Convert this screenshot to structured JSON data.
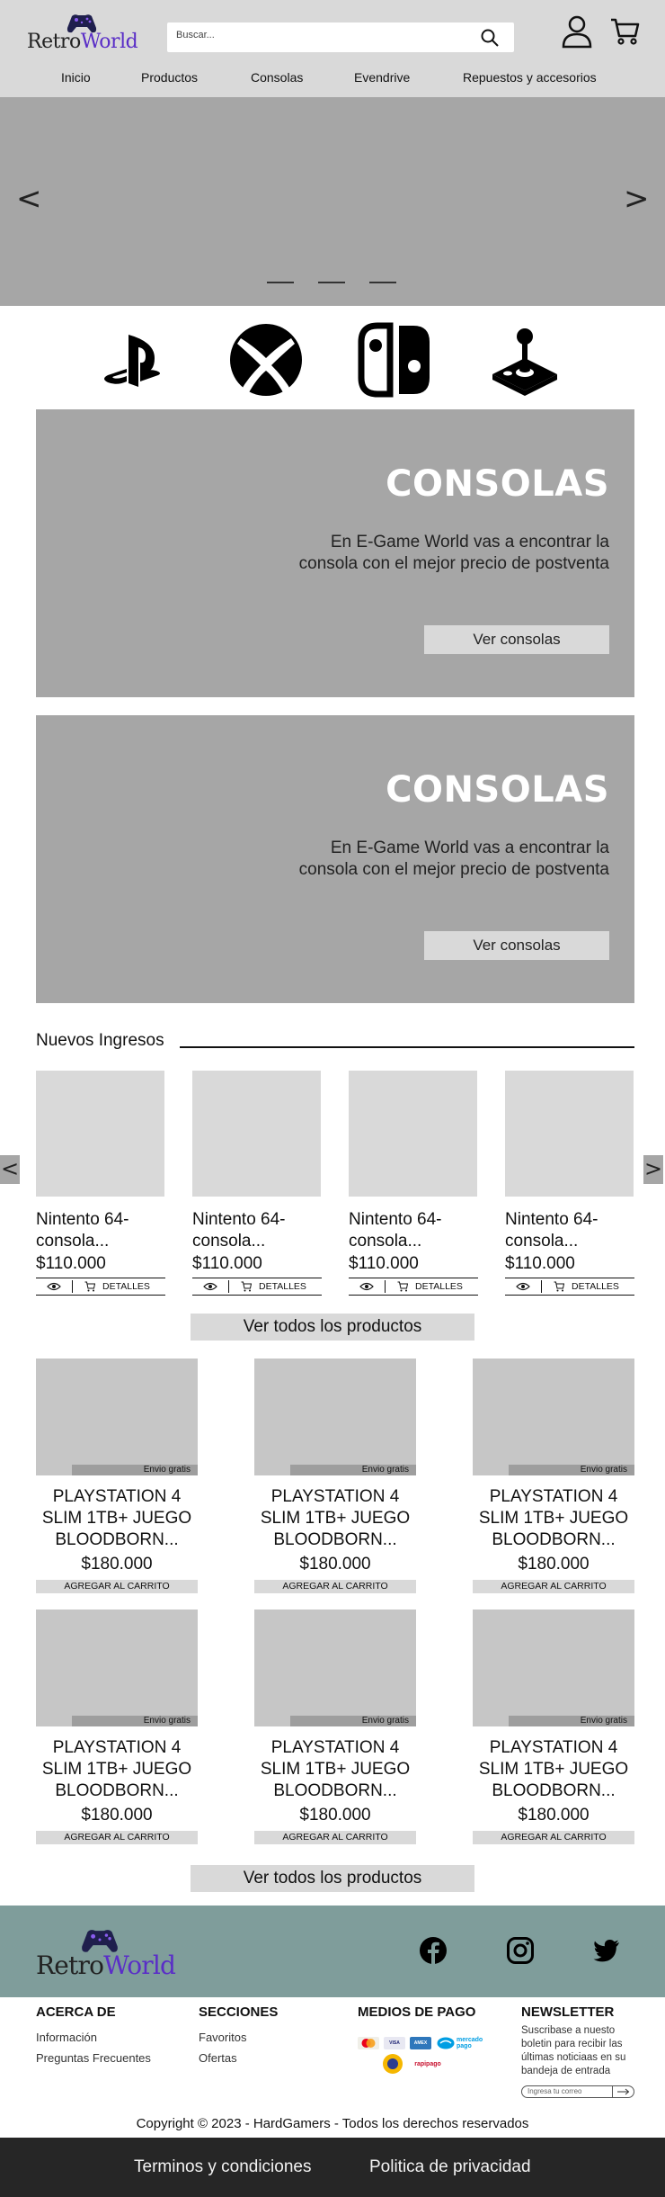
{
  "header": {
    "logo": {
      "part1": "Retro",
      "part2": "World"
    },
    "search_placeholder": "Buscar...",
    "nav": [
      "Inicio",
      "Productos",
      "Consolas",
      "Evendrive",
      "Repuestos y accesorios"
    ]
  },
  "hero": {
    "prev": "<",
    "next": ">",
    "slides": 3
  },
  "brands": [
    "playstation-icon",
    "xbox-icon",
    "nintendo-switch-icon",
    "joystick-icon"
  ],
  "promos": [
    {
      "title": "CONSOLAS",
      "text": "En E-Game World vas a encontrar la consola con el mejor precio de postventa",
      "button": "Ver consolas"
    },
    {
      "title": "CONSOLAS",
      "text": "En E-Game World vas a encontrar la consola con el mejor precio de postventa",
      "button": "Ver consolas"
    }
  ],
  "nuevos_ingresos": {
    "title": "Nuevos Ingresos",
    "prev": "<",
    "next": ">",
    "items": [
      {
        "name": "Nintento 64- consola...",
        "price": "$110.000",
        "details": "DETALLES"
      },
      {
        "name": "Nintento 64- consola...",
        "price": "$110.000",
        "details": "DETALLES"
      },
      {
        "name": "Nintento 64- consola...",
        "price": "$110.000",
        "details": "DETALLES"
      },
      {
        "name": "Nintento 64- consola...",
        "price": "$110.000",
        "details": "DETALLES"
      }
    ],
    "view_all": "Ver todos los productos"
  },
  "products": {
    "items": [
      {
        "name": "PLAYSTATION 4 SLIM 1TB+ JUEGO BLOODBORN...",
        "price": "$180.000",
        "badge": "Envio gratis",
        "button": "AGREGAR AL CARRITO"
      },
      {
        "name": "PLAYSTATION 4 SLIM 1TB+ JUEGO BLOODBORN...",
        "price": "$180.000",
        "badge": "Envio gratis",
        "button": "AGREGAR AL CARRITO"
      },
      {
        "name": "PLAYSTATION 4 SLIM 1TB+ JUEGO BLOODBORN...",
        "price": "$180.000",
        "badge": "Envio gratis",
        "button": "AGREGAR AL CARRITO"
      },
      {
        "name": "PLAYSTATION 4 SLIM 1TB+ JUEGO BLOODBORN...",
        "price": "$180.000",
        "badge": "Envio gratis",
        "button": "AGREGAR AL CARRITO"
      },
      {
        "name": "PLAYSTATION 4 SLIM 1TB+ JUEGO BLOODBORN...",
        "price": "$180.000",
        "badge": "Envio gratis",
        "button": "AGREGAR AL CARRITO"
      },
      {
        "name": "PLAYSTATION 4 SLIM 1TB+ JUEGO BLOODBORN...",
        "price": "$180.000",
        "badge": "Envio gratis",
        "button": "AGREGAR AL CARRITO"
      }
    ],
    "view_all": "Ver todos los productos"
  },
  "footer": {
    "logo": {
      "part1": "Retro",
      "part2": "World"
    },
    "social": [
      "facebook-icon",
      "instagram-icon",
      "twitter-icon"
    ],
    "about": {
      "title": "ACERCA DE",
      "links": [
        "Información",
        "Preguntas Frecuentes"
      ]
    },
    "sections": {
      "title": "SECCIONES",
      "links": [
        "Favoritos",
        "Ofertas"
      ]
    },
    "payments": {
      "title": "MEDIOS DE PAGO",
      "methods": [
        "mastercard",
        "visa",
        "american express",
        "mercado pago",
        "pago fácil",
        "rapipago"
      ],
      "mercado_label": "mercado pago",
      "rapipago_label": "rapipago"
    },
    "newsletter": {
      "title": "NEWSLETTER",
      "text": "Suscribase a nuesto boletin para recibir las últimas noticiaas en su bandeja de entrada",
      "placeholder": "Ingresa tu correo"
    },
    "copyright": "Copyright © 2023 - HardGamers - Todos los derechos reservados",
    "bottom_links": [
      "Terminos y condiciones",
      "Politica de privacidad"
    ]
  },
  "colors": {
    "header_bg": "#d9d9d9",
    "hero_bg": "#a6a6a6",
    "footer_band": "#7f9d9b",
    "bottom_bar": "#262626",
    "brand_purple": "#5a2ec7"
  }
}
